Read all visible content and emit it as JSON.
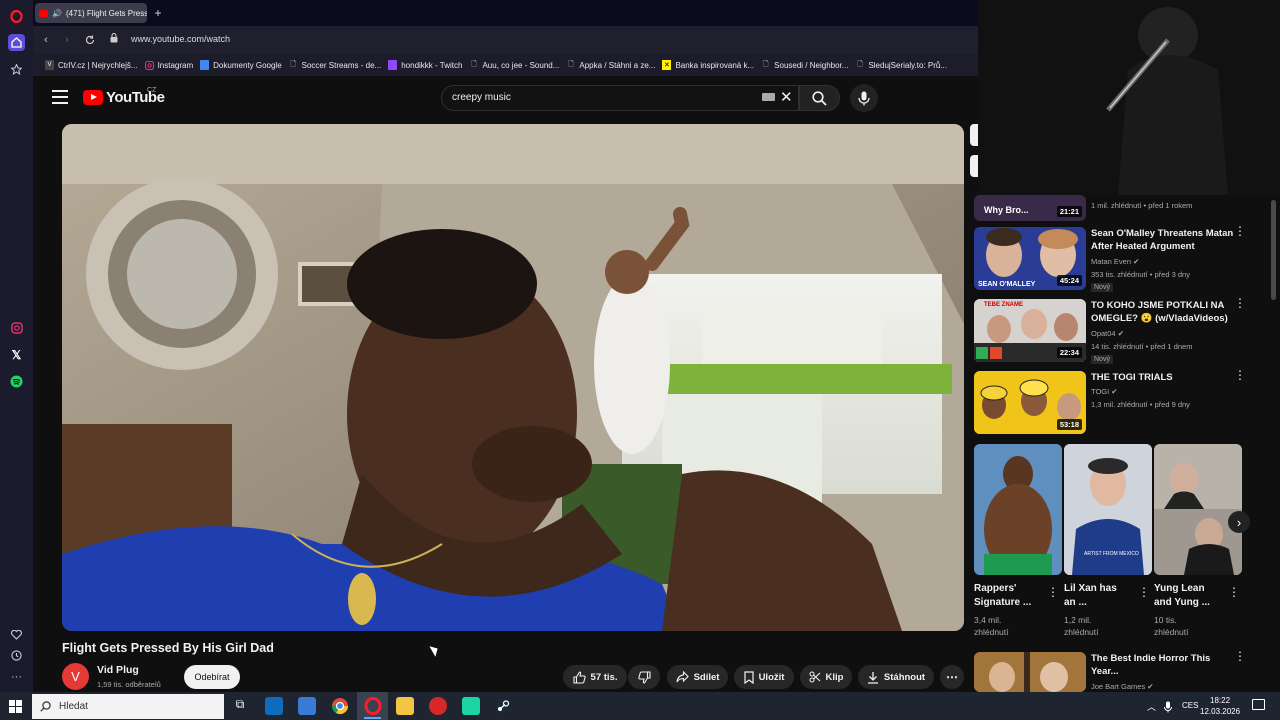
{
  "browser": {
    "tab_title": "(471) Flight Gets Press",
    "url": "www.youtube.com/watch",
    "bookmarks": [
      "CtrlV.cz | Nejrychlejš...",
      "Instagram",
      "Dokumenty Google",
      "Soccer Streams - de...",
      "hondikkk - Twitch",
      "Auu, co jee - Sound...",
      "Appka / Stáhni a ze...",
      "Banka inspirovaná k...",
      "Sousedi / Neighbor...",
      "SledujSerialy.to: Prů..."
    ]
  },
  "youtube": {
    "logo_text": "YouTube",
    "region": "CZ",
    "search_value": "creepy music"
  },
  "video": {
    "title": "Flight Gets Pressed By His Girl Dad",
    "channel_initial": "V",
    "channel_name": "Vid Plug",
    "subscribers": "1,59 tis. odběratelů",
    "subscribe_label": "Odebírat",
    "likes": "57 tis.",
    "share_label": "Sdílet",
    "save_label": "Uložit",
    "clip_label": "Klip",
    "download_label": "Stáhnout"
  },
  "recommendations": [
    {
      "title": "",
      "channel": "",
      "meta": "1 mil. zhlédnutí • před 1 rokem",
      "duration": "21:21",
      "thumb_text": "Why Bro..."
    },
    {
      "title_line1": "Sean O'Malley Threatens Matan",
      "title_line2": "After Heated Argument",
      "channel": "Matan Even",
      "meta": "353 tis. zhlédnutí • před 3 dny",
      "badge": "Nový",
      "duration": "45:24",
      "thumb_text": "SEAN O'MALLEY"
    },
    {
      "title_line1": "TO KOHO JSME POTKALI NA",
      "title_line2": "OMEGLE? 😮 (w/VladaVideos)",
      "channel": "Opat04",
      "meta": "14 tis. zhlédnutí • před 1 dnem",
      "badge": "Nový",
      "duration": "22:34",
      "thumb_text": "TEBE ZNAME"
    },
    {
      "title_line1": "THE TOGI TRIALS",
      "title_line2": "",
      "channel": "TOGI",
      "meta": "1,3 mil. zhlédnutí • před 9 dny",
      "duration": "53:18"
    },
    {
      "title_line1": "The Best Indie Horror This",
      "title_line2": "Year...",
      "channel": "Joe Bart Games"
    }
  ],
  "shorts": [
    {
      "title_line1": "Rappers'",
      "title_line2": "Signature ...",
      "views_line1": "3,4 mil.",
      "views_line2": "zhlédnutí"
    },
    {
      "title_line1": "Lil Xan has",
      "title_line2": "an ...",
      "views_line1": "1,2 mil.",
      "views_line2": "zhlédnutí",
      "thumb_text": "ARTIST FROM MEXICO"
    },
    {
      "title_line1": "Yung Lean",
      "title_line2": "and Yung ...",
      "views_line1": "10 tis.",
      "views_line2": "zhlédnutí"
    }
  ],
  "taskbar": {
    "search_placeholder": "Hledat",
    "language": "CES",
    "time": "18:22",
    "date": "12.03.2026"
  },
  "colors": {
    "youtube_red": "#ff0000",
    "background": "#0f0f0f",
    "pill": "#272727"
  }
}
